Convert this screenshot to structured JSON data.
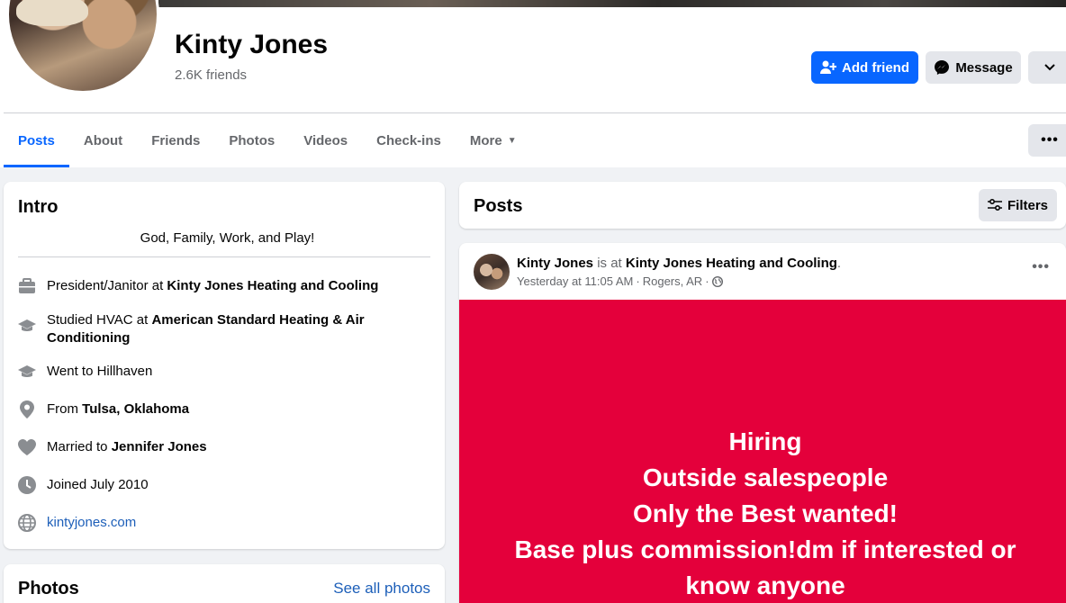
{
  "profile": {
    "name": "Kinty Jones",
    "friends": "2.6K friends"
  },
  "actions": {
    "add_friend": "Add friend",
    "message": "Message"
  },
  "tabs": [
    {
      "label": "Posts",
      "active": true
    },
    {
      "label": "About"
    },
    {
      "label": "Friends"
    },
    {
      "label": "Photos"
    },
    {
      "label": "Videos"
    },
    {
      "label": "Check-ins"
    },
    {
      "label": "More"
    }
  ],
  "intro": {
    "title": "Intro",
    "bio": "God, Family, Work, and Play!",
    "work": {
      "prefix": "President/Janitor at ",
      "bold": "Kinty Jones Heating and Cooling"
    },
    "studied": {
      "prefix": "Studied HVAC at ",
      "bold": "American Standard Heating & Air Conditioning"
    },
    "went": {
      "text": "Went to Hillhaven"
    },
    "from": {
      "prefix": "From ",
      "bold": "Tulsa, Oklahoma"
    },
    "married": {
      "prefix": "Married to ",
      "bold": "Jennifer Jones"
    },
    "joined": {
      "text": "Joined July 2010"
    },
    "website": {
      "text": "kintyjones.com"
    }
  },
  "photos": {
    "title": "Photos",
    "see_all": "See all photos"
  },
  "posts": {
    "title": "Posts",
    "filters": "Filters"
  },
  "post": {
    "author": "Kinty Jones",
    "is_at": " is at ",
    "place": "Kinty Jones Heating and Cooling",
    "period": ".",
    "time": "Yesterday at 11:05 AM",
    "sep": " · ",
    "location": "Rogers, AR",
    "sep2": " · ",
    "banner_lines": [
      "Hiring",
      "Outside salespeople",
      "Only the Best wanted!",
      "Base plus commission!dm if interested or",
      "know anyone"
    ],
    "banner_color": "#e4003b"
  },
  "colors": {
    "accent": "#0866ff",
    "link": "#1d5fb9",
    "muted": "#65676b"
  }
}
